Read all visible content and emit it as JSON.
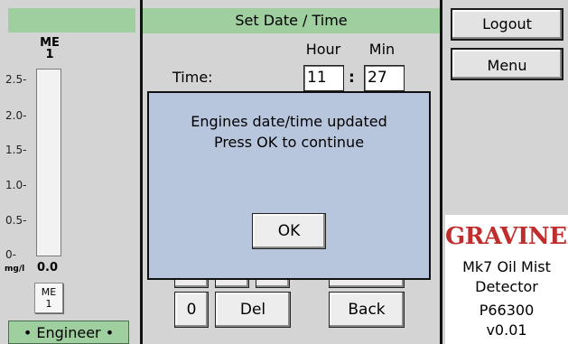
{
  "gauge": {
    "id_line1": "ME",
    "id_line2": "1",
    "ticks": [
      "2.5-",
      "2.0-",
      "1.5-",
      "1.0-",
      "0.5-",
      "0-"
    ],
    "unit": "mg/l",
    "value": "0.0",
    "me_button_line1": "ME",
    "me_button_line2": "1"
  },
  "role_badge": "• Engineer •",
  "screen": {
    "title": "Set Date / Time",
    "hour_label": "Hour",
    "min_label": "Min",
    "time_label": "Time:",
    "hour_value": "11",
    "min_value": "27",
    "separator": ":"
  },
  "keypad": {
    "zero": "0",
    "del": "Del",
    "back": "Back"
  },
  "dialog": {
    "line1": "Engines date/time updated",
    "line2": "Press OK to continue",
    "ok": "OK"
  },
  "sidebar": {
    "logout": "Logout",
    "menu": "Menu"
  },
  "brand": {
    "logo_text": "GRAVINER",
    "product_line1": "Mk7 Oil Mist",
    "product_line2": "Detector",
    "code": "P66300",
    "version": "v0.01"
  },
  "colors": {
    "header_green": "#9fce9f",
    "dialog_blue": "#b8c6dd",
    "panel_gray": "#d4d4d4",
    "brand_red": "#c02d2d"
  }
}
